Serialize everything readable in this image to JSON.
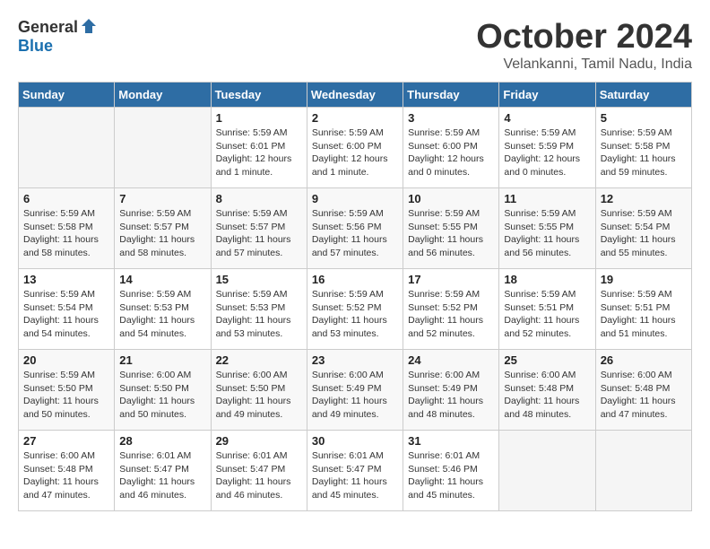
{
  "header": {
    "logo_general": "General",
    "logo_blue": "Blue",
    "title": "October 2024",
    "location": "Velankanni, Tamil Nadu, India"
  },
  "calendar": {
    "days_of_week": [
      "Sunday",
      "Monday",
      "Tuesday",
      "Wednesday",
      "Thursday",
      "Friday",
      "Saturday"
    ],
    "weeks": [
      [
        {
          "day": "",
          "info": ""
        },
        {
          "day": "",
          "info": ""
        },
        {
          "day": "1",
          "info": "Sunrise: 5:59 AM\nSunset: 6:01 PM\nDaylight: 12 hours\nand 1 minute."
        },
        {
          "day": "2",
          "info": "Sunrise: 5:59 AM\nSunset: 6:00 PM\nDaylight: 12 hours\nand 1 minute."
        },
        {
          "day": "3",
          "info": "Sunrise: 5:59 AM\nSunset: 6:00 PM\nDaylight: 12 hours\nand 0 minutes."
        },
        {
          "day": "4",
          "info": "Sunrise: 5:59 AM\nSunset: 5:59 PM\nDaylight: 12 hours\nand 0 minutes."
        },
        {
          "day": "5",
          "info": "Sunrise: 5:59 AM\nSunset: 5:58 PM\nDaylight: 11 hours\nand 59 minutes."
        }
      ],
      [
        {
          "day": "6",
          "info": "Sunrise: 5:59 AM\nSunset: 5:58 PM\nDaylight: 11 hours\nand 58 minutes."
        },
        {
          "day": "7",
          "info": "Sunrise: 5:59 AM\nSunset: 5:57 PM\nDaylight: 11 hours\nand 58 minutes."
        },
        {
          "day": "8",
          "info": "Sunrise: 5:59 AM\nSunset: 5:57 PM\nDaylight: 11 hours\nand 57 minutes."
        },
        {
          "day": "9",
          "info": "Sunrise: 5:59 AM\nSunset: 5:56 PM\nDaylight: 11 hours\nand 57 minutes."
        },
        {
          "day": "10",
          "info": "Sunrise: 5:59 AM\nSunset: 5:55 PM\nDaylight: 11 hours\nand 56 minutes."
        },
        {
          "day": "11",
          "info": "Sunrise: 5:59 AM\nSunset: 5:55 PM\nDaylight: 11 hours\nand 56 minutes."
        },
        {
          "day": "12",
          "info": "Sunrise: 5:59 AM\nSunset: 5:54 PM\nDaylight: 11 hours\nand 55 minutes."
        }
      ],
      [
        {
          "day": "13",
          "info": "Sunrise: 5:59 AM\nSunset: 5:54 PM\nDaylight: 11 hours\nand 54 minutes."
        },
        {
          "day": "14",
          "info": "Sunrise: 5:59 AM\nSunset: 5:53 PM\nDaylight: 11 hours\nand 54 minutes."
        },
        {
          "day": "15",
          "info": "Sunrise: 5:59 AM\nSunset: 5:53 PM\nDaylight: 11 hours\nand 53 minutes."
        },
        {
          "day": "16",
          "info": "Sunrise: 5:59 AM\nSunset: 5:52 PM\nDaylight: 11 hours\nand 53 minutes."
        },
        {
          "day": "17",
          "info": "Sunrise: 5:59 AM\nSunset: 5:52 PM\nDaylight: 11 hours\nand 52 minutes."
        },
        {
          "day": "18",
          "info": "Sunrise: 5:59 AM\nSunset: 5:51 PM\nDaylight: 11 hours\nand 52 minutes."
        },
        {
          "day": "19",
          "info": "Sunrise: 5:59 AM\nSunset: 5:51 PM\nDaylight: 11 hours\nand 51 minutes."
        }
      ],
      [
        {
          "day": "20",
          "info": "Sunrise: 5:59 AM\nSunset: 5:50 PM\nDaylight: 11 hours\nand 50 minutes."
        },
        {
          "day": "21",
          "info": "Sunrise: 6:00 AM\nSunset: 5:50 PM\nDaylight: 11 hours\nand 50 minutes."
        },
        {
          "day": "22",
          "info": "Sunrise: 6:00 AM\nSunset: 5:50 PM\nDaylight: 11 hours\nand 49 minutes."
        },
        {
          "day": "23",
          "info": "Sunrise: 6:00 AM\nSunset: 5:49 PM\nDaylight: 11 hours\nand 49 minutes."
        },
        {
          "day": "24",
          "info": "Sunrise: 6:00 AM\nSunset: 5:49 PM\nDaylight: 11 hours\nand 48 minutes."
        },
        {
          "day": "25",
          "info": "Sunrise: 6:00 AM\nSunset: 5:48 PM\nDaylight: 11 hours\nand 48 minutes."
        },
        {
          "day": "26",
          "info": "Sunrise: 6:00 AM\nSunset: 5:48 PM\nDaylight: 11 hours\nand 47 minutes."
        }
      ],
      [
        {
          "day": "27",
          "info": "Sunrise: 6:00 AM\nSunset: 5:48 PM\nDaylight: 11 hours\nand 47 minutes."
        },
        {
          "day": "28",
          "info": "Sunrise: 6:01 AM\nSunset: 5:47 PM\nDaylight: 11 hours\nand 46 minutes."
        },
        {
          "day": "29",
          "info": "Sunrise: 6:01 AM\nSunset: 5:47 PM\nDaylight: 11 hours\nand 46 minutes."
        },
        {
          "day": "30",
          "info": "Sunrise: 6:01 AM\nSunset: 5:47 PM\nDaylight: 11 hours\nand 45 minutes."
        },
        {
          "day": "31",
          "info": "Sunrise: 6:01 AM\nSunset: 5:46 PM\nDaylight: 11 hours\nand 45 minutes."
        },
        {
          "day": "",
          "info": ""
        },
        {
          "day": "",
          "info": ""
        }
      ]
    ]
  }
}
